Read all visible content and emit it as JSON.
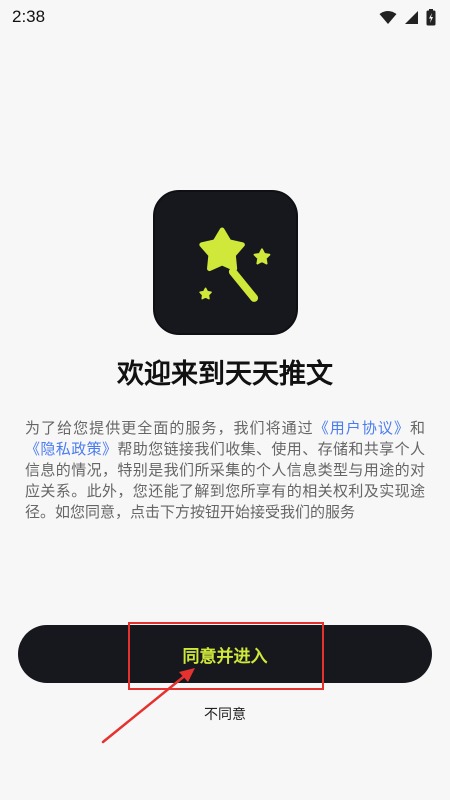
{
  "status_bar": {
    "time": "2:38"
  },
  "welcome": {
    "title": "欢迎来到天天推文"
  },
  "intro": {
    "part1": "为了给您提供更全面的服务，我们将通过",
    "user_agreement_link": "《用户协议》",
    "part2": "和",
    "privacy_policy_link": "《隐私政策》",
    "part3": "帮助您链接我们收集、使用、存储和共享个人信息的情况，特别是我们所采集的个人信息类型与用途的对应关系。此外，您还能了解到您所享有的相关权利及实现途径。如您同意，点击下方按钮开始接受我们的服务"
  },
  "buttons": {
    "agree": "同意并进入",
    "disagree": "不同意"
  },
  "colors": {
    "icon_background": "#16181d",
    "accent_lime": "#cfe83a",
    "link_blue": "#4a7cf0",
    "annotation_red": "#e5322f"
  },
  "icons": {
    "app": "magic-wand-star-icon"
  }
}
